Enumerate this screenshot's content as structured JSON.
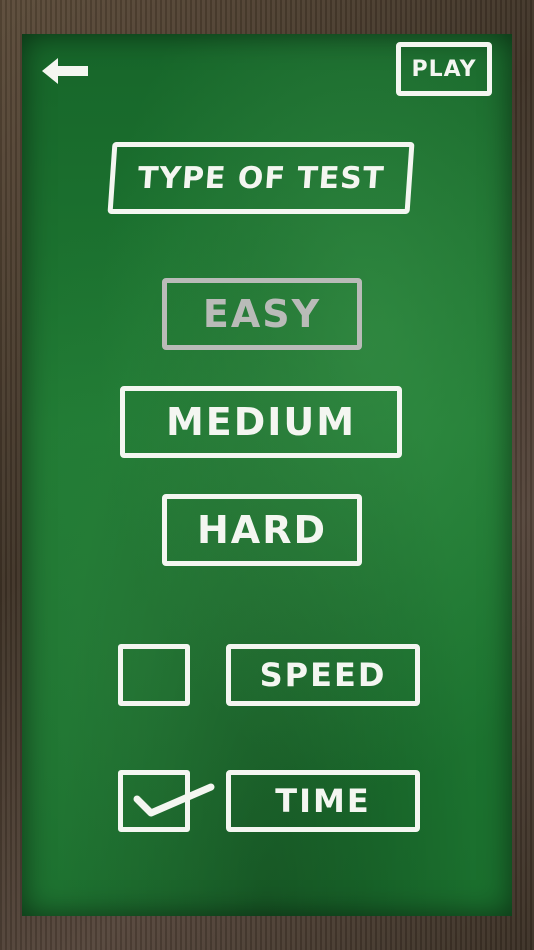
{
  "header": {
    "back_icon": "arrow-left-icon",
    "play_label": "PLAY"
  },
  "title": "TYPE OF TEST",
  "difficulty": {
    "options": [
      "EASY",
      "MEDIUM",
      "HARD"
    ],
    "selected": "EASY"
  },
  "modes": {
    "speed": {
      "label": "SPEED",
      "checked": false
    },
    "time": {
      "label": "TIME",
      "checked": true
    }
  },
  "colors": {
    "chalk": "#f4f6f1",
    "selected_chalk": "#b9bbb8",
    "board": "#1f7a33",
    "frame": "#4a3b2c"
  }
}
